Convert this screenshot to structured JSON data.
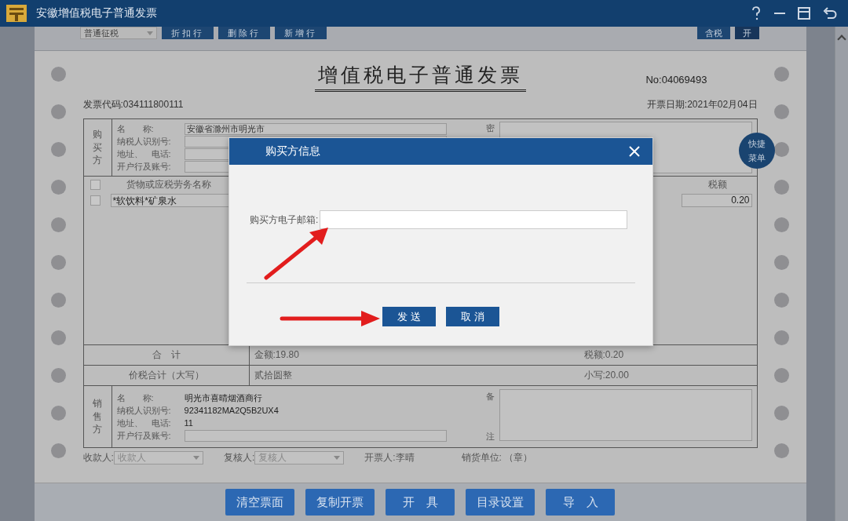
{
  "window": {
    "title": "安徽增值税电子普通发票"
  },
  "toolbar": {
    "tax_type": "普通征税",
    "buttons": [
      "折扣行",
      "删除行",
      "新增行"
    ],
    "tax_toggle": [
      {
        "label": "含税",
        "selected": false
      },
      {
        "label": "开",
        "selected": true
      }
    ]
  },
  "invoice": {
    "title": "增值税电子普通发票",
    "number": "No:04069493",
    "code": "发票代码:034111800111",
    "date": "开票日期:2021年02月04日",
    "buyer": {
      "heading": "购买方",
      "fields": [
        {
          "label": "名　　称:",
          "value": "安徽省滁州市明光市"
        },
        {
          "label": "纳税人识别号:"
        },
        {
          "label": "地址、　电话:"
        },
        {
          "label": "开户行及账号:"
        }
      ],
      "password_label": "密"
    },
    "goods": {
      "select_all": {
        "checked": false
      },
      "columns": [
        "货物或应税劳务名称",
        "税额"
      ],
      "rows": [
        {
          "checked": false,
          "name": "*软饮料*矿泉水",
          "tax": "0.20"
        }
      ]
    },
    "total": {
      "label": "合　计",
      "amount": "金额:19.80",
      "tax": "税额:0.20"
    },
    "grand_total": {
      "label": "价税合计（大写）",
      "words": "贰拾圆整",
      "figure": "小写:20.00"
    },
    "seller": {
      "heading": "销售方",
      "fields": [
        {
          "label": "名　　称:",
          "value": "明光市喜晴烟酒商行"
        },
        {
          "label": "纳税人识别号:",
          "value": "92341182MA2Q5B2UX4"
        },
        {
          "label": "地址、　电话:",
          "value": "11"
        },
        {
          "label": "开户行及账号:",
          "kind": "input"
        }
      ],
      "remarks_label": [
        "备",
        "注"
      ]
    },
    "footer": [
      {
        "kind": "select",
        "label": "收款人:",
        "placeholder": "收款人"
      },
      {
        "kind": "select",
        "label": "复核人:",
        "placeholder": "复核人"
      },
      {
        "kind": "text",
        "label": "开票人:李晴"
      },
      {
        "kind": "text",
        "label": "销货单位: （章）"
      }
    ]
  },
  "quick_menu": "快捷菜单",
  "actions": [
    "清空票面",
    "复制开票",
    "开　具",
    "目录设置",
    "导　入"
  ],
  "dialog": {
    "title": "购买方信息",
    "email_label": "购买方电子邮箱:",
    "buttons": [
      "发 送",
      "取 消"
    ]
  }
}
